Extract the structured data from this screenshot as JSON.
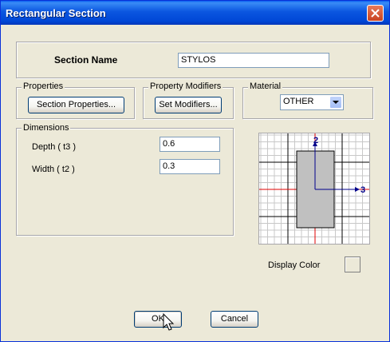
{
  "window": {
    "title": "Rectangular Section"
  },
  "section": {
    "name_label": "Section Name",
    "name_value": "STYLOS"
  },
  "properties": {
    "legend": "Properties",
    "button": "Section Properties..."
  },
  "modifiers": {
    "legend": "Property Modifiers",
    "button": "Set Modifiers..."
  },
  "material": {
    "legend": "Material",
    "selected": "OTHER"
  },
  "dimensions": {
    "legend": "Dimensions",
    "depth_label": "Depth  ( t3 )",
    "depth_value": "0.6",
    "width_label": "Width  ( t2 )",
    "width_value": "0.3"
  },
  "preview": {
    "axis_vertical": "2",
    "axis_horizontal": "3",
    "grid_color": "#c8c8c8",
    "section_fill": "#c0c0c0"
  },
  "display_color": {
    "label": "Display Color"
  },
  "footer": {
    "ok": "OK",
    "cancel": "Cancel"
  }
}
